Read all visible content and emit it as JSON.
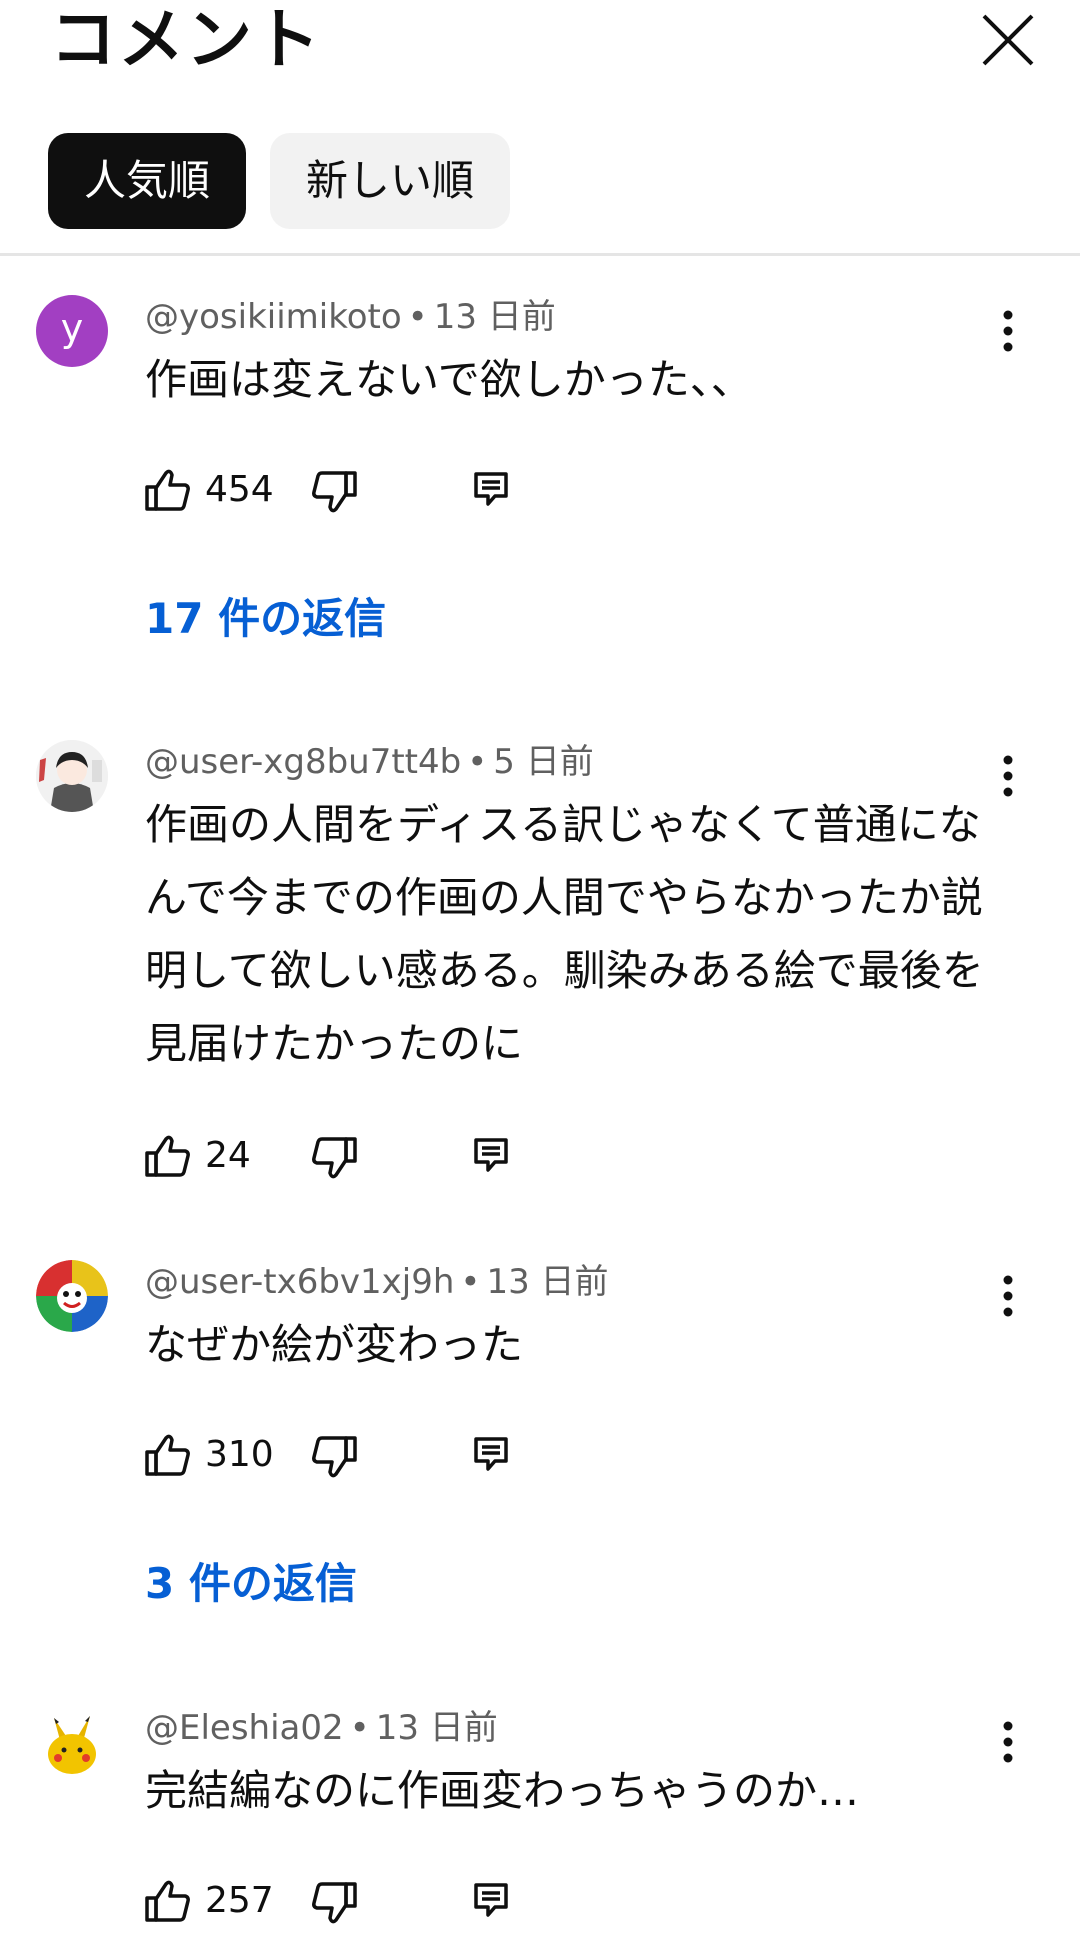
{
  "header": {
    "title": "コメント",
    "close_icon": "close-icon"
  },
  "sort_chips": [
    {
      "label": "人気順",
      "selected": true
    },
    {
      "label": "新しい順",
      "selected": false
    }
  ],
  "colors": {
    "link_blue": "#065fd4",
    "selected_chip": "#0f0f0f",
    "unselected_chip": "#f2f2f2",
    "avatar_purple": "#a23fc2"
  },
  "comments": [
    {
      "handle": "@yosikiimikoto",
      "time": "13 日前",
      "avatar_letter": "y",
      "text": "作画は変えないで欲しかった、、",
      "likes": "454",
      "replies": "17 件の返信"
    },
    {
      "handle": "@user-xg8bu7tt4b",
      "time": "5 日前",
      "avatar": "illustrated-avatar",
      "text": "作画の人間をディスる訳じゃなくて普通になんで今までの作画の人間でやらなかったか説明して欲しい感ある。馴染みある絵で最後を見届けたかったのに",
      "likes": "24"
    },
    {
      "handle": "@user-tx6bv1xj9h",
      "time": "13 日前",
      "avatar": "colorful-face-avatar",
      "text": "なぜか絵が変わった",
      "likes": "310",
      "replies": "3 件の返信"
    },
    {
      "handle": "@Eleshia02",
      "time": "13 日前",
      "avatar": "pikachu-avatar",
      "text": "完結編なのに作画変わっちゃうのか…",
      "likes": "257"
    }
  ]
}
